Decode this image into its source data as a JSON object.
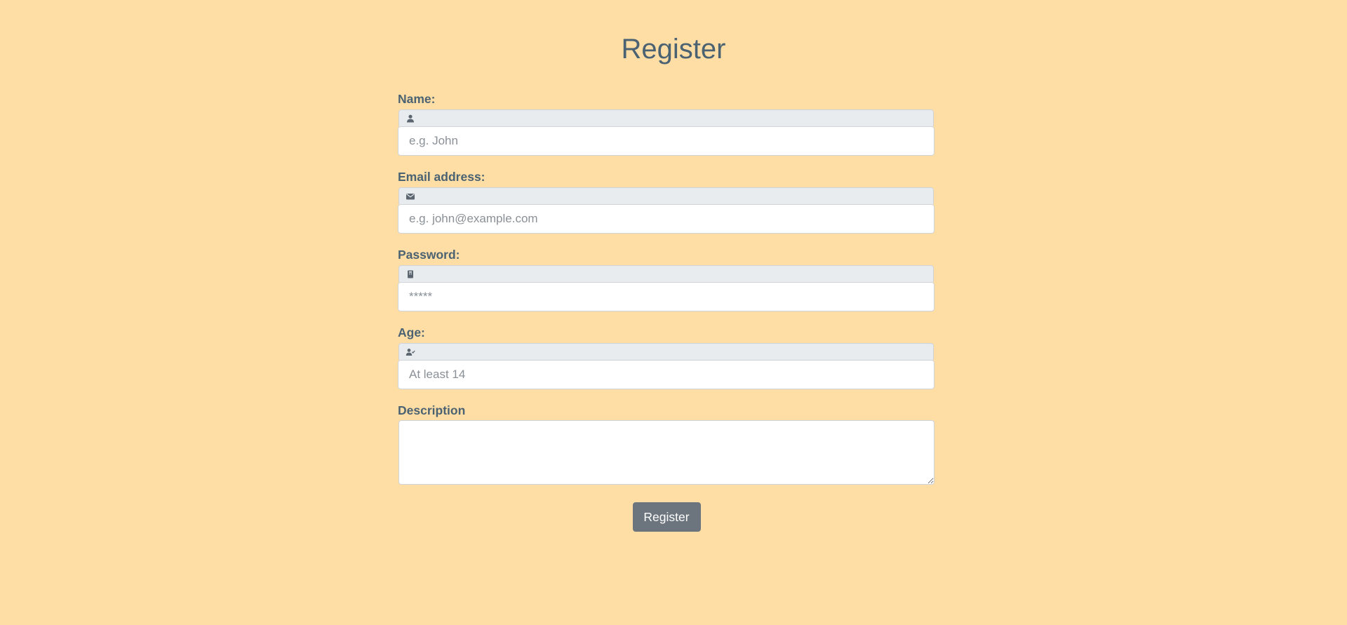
{
  "page": {
    "title": "Register"
  },
  "form": {
    "name": {
      "label": "Name:",
      "icon": "user-icon",
      "placeholder": "e.g. John",
      "value": ""
    },
    "email": {
      "label": "Email address:",
      "icon": "envelope-icon",
      "placeholder": "e.g. john@example.com",
      "value": ""
    },
    "password": {
      "label": "Password:",
      "icon": "key-icon",
      "placeholder": "*****",
      "value": ""
    },
    "age": {
      "label": "Age:",
      "icon": "user-check-icon",
      "placeholder": "At least 14",
      "value": ""
    },
    "description": {
      "label": "Description",
      "value": ""
    },
    "submit_label": "Register"
  },
  "colors": {
    "background": "#fedea5",
    "text": "#4b6272",
    "button": "#6c757d",
    "icon_strip": "#e9ecef"
  }
}
